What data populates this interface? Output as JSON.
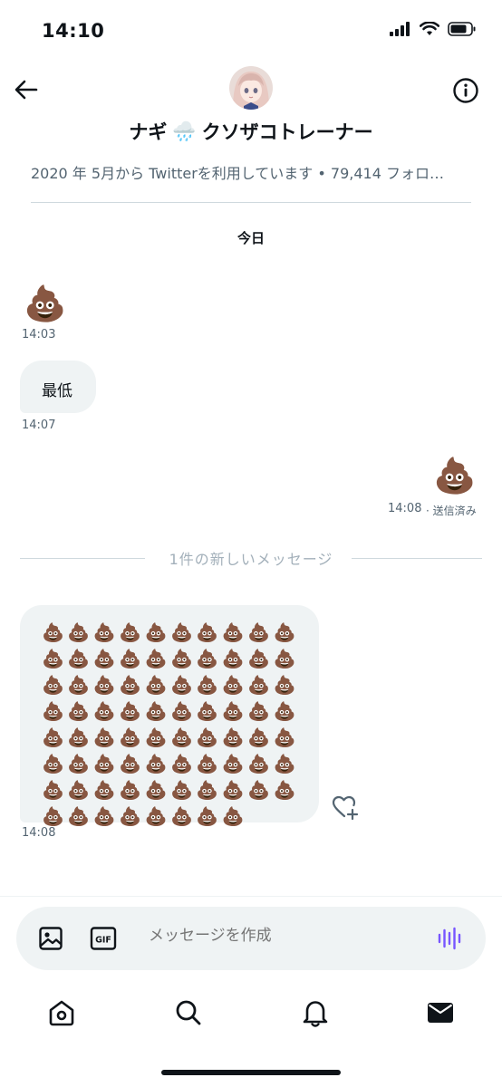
{
  "status_bar": {
    "time": "14:10"
  },
  "header": {
    "name_left": "ナギ",
    "name_emoji": "🌧️",
    "name_right": "クソザコトレーナー"
  },
  "profile_meta": "2020 年 5月から Twitterを利用しています • 79,414 フォロ…",
  "day_label": "今日",
  "messages": [
    {
      "content": "💩",
      "time": "14:03"
    },
    {
      "content": "最低",
      "time": "14:07"
    },
    {
      "content": "💩",
      "time": "14:08",
      "status": "· 送信済み"
    },
    {
      "content": "💩",
      "time": "14:08",
      "count": 78
    }
  ],
  "new_messages_divider": "1件の新しいメッセージ",
  "composer": {
    "placeholder": "メッセージを作成",
    "gif_label": "GIF"
  },
  "icons": {
    "back": "back-arrow-icon",
    "info": "info-icon",
    "image": "image-icon",
    "gif": "gif-icon",
    "voice": "voice-wave-icon",
    "react": "heart-plus-icon",
    "home": "home-icon",
    "search": "search-icon",
    "notifications": "bell-icon",
    "messages": "envelope-icon"
  },
  "colors": {
    "accent": "#1d9bf0",
    "voice": "#7856ff",
    "bubble": "#eff3f4",
    "muted": "#536471"
  }
}
